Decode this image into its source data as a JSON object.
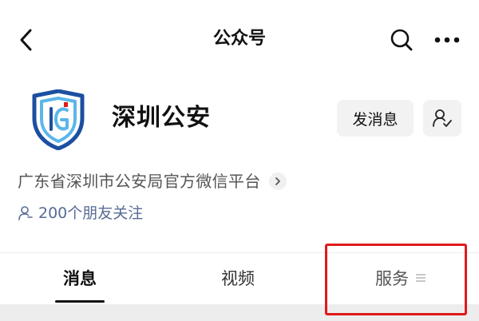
{
  "header": {
    "title": "公众号",
    "back_icon": "chevron-left-icon",
    "search_icon": "search-icon",
    "more_icon": "more-dots-icon"
  },
  "profile": {
    "name": "深圳公安",
    "logo_icon": "shield-logo-icon",
    "message_label": "发消息",
    "follow_icon": "user-check-icon",
    "description": "广东省深圳市公安局官方微信平台",
    "followers_text": "200个朋友关注"
  },
  "tabs": [
    {
      "label": "消息",
      "active": true
    },
    {
      "label": "视频",
      "active": false
    },
    {
      "label": "服务",
      "active": false,
      "icon": "menu-lines-icon"
    }
  ],
  "colors": {
    "followers_link": "#576b95",
    "highlight_box": "#e0191b",
    "logo_blue": "#1c4fa0",
    "logo_light_blue": "#5bb6e8",
    "logo_red": "#e0191b"
  }
}
